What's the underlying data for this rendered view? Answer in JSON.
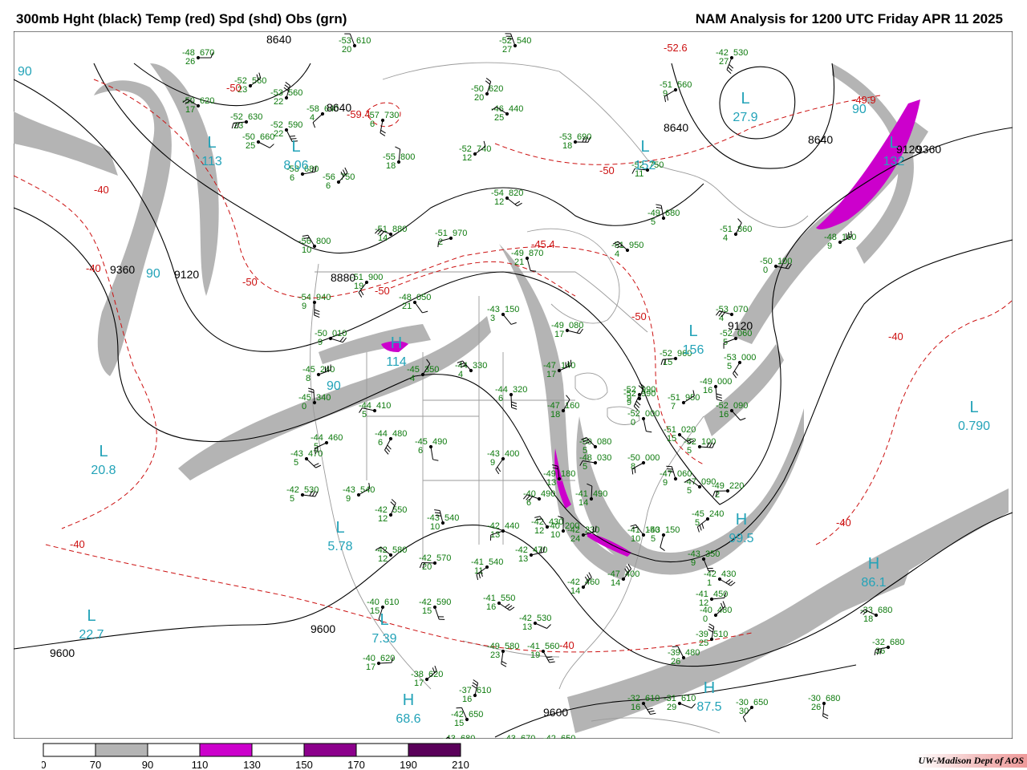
{
  "title_left": "300mb Hght (black) Temp (red) Spd (shd) Obs (grn)",
  "title_right": "NAM Analysis for 1200 UTC Friday  APR 11 2025",
  "credit": "UW-Madison  Dept of AOS",
  "colors": {
    "height": "#000000",
    "temp": "#cc1111",
    "obs": "#0d7a0d",
    "centers": "#23a3b8",
    "boundary": "#9a9a9a",
    "speed_70_90": "#b4b4b4",
    "speed_90_110": "#ffffff",
    "speed_110_130": "#cc00cc",
    "speed_130_150": "#ffffff",
    "speed_150_170": "#8c008c",
    "speed_170_190": "#ffffff",
    "speed_190_210": "#5a005a"
  },
  "colorbar": {
    "ticks": [
      "0",
      "70",
      "90",
      "110",
      "130",
      "150",
      "170",
      "190",
      "210"
    ],
    "fills": [
      "#ffffff",
      "#b4b4b4",
      "#ffffff",
      "#cc00cc",
      "#ffffff",
      "#8c008c",
      "#ffffff",
      "#5a005a",
      "#ffffff"
    ]
  },
  "height_labels": [
    "8640",
    "8640",
    "8640",
    "8880",
    "9120",
    "9120",
    "9120",
    "9360",
    "9360",
    "9600",
    "9600",
    "9600",
    "8640"
  ],
  "temp_labels": [
    "-40",
    "-40",
    "-40",
    "-40",
    "-40",
    "-40",
    "-50",
    "-50",
    "-50",
    "-50",
    "-50",
    "-52.6",
    "-49.9",
    "-59.4",
    "-45.4"
  ],
  "centers": [
    {
      "type": "L",
      "value": "8.06"
    },
    {
      "type": "L",
      "value": "113"
    },
    {
      "type": "L",
      "value": "27.9"
    },
    {
      "type": "L",
      "value": "132"
    },
    {
      "type": "H",
      "value": "114"
    },
    {
      "type": "L",
      "value": "20.8"
    },
    {
      "type": "L",
      "value": "5.78"
    },
    {
      "type": "L",
      "value": "22.7"
    },
    {
      "type": "L",
      "value": "7.39"
    },
    {
      "type": "H",
      "value": "68.6"
    },
    {
      "type": "H",
      "value": "86.1"
    },
    {
      "type": "H",
      "value": "99.5"
    },
    {
      "type": "L",
      "value": "0.790"
    },
    {
      "type": "L",
      "value": "156"
    },
    {
      "type": "H",
      "value": "87.5"
    },
    {
      "type": "L",
      "value": "152"
    }
  ],
  "speed_labels": [
    "90",
    "90",
    "90",
    "90"
  ],
  "observations": [
    {
      "temp": "-48",
      "hgt": "670",
      "dew": "26"
    },
    {
      "temp": "-52",
      "hgt": "560",
      "dew": "23"
    },
    {
      "temp": "-53",
      "hgt": "560",
      "dew": "22"
    },
    {
      "temp": "-53",
      "hgt": "610",
      "dew": "20"
    },
    {
      "temp": "-50",
      "hgt": "620",
      "dew": "17"
    },
    {
      "temp": "-52",
      "hgt": "630",
      "dew": "23"
    },
    {
      "temp": "-58",
      "hgt": "640",
      "dew": "4"
    },
    {
      "temp": "-57",
      "hgt": "730",
      "dew": "6"
    },
    {
      "temp": "-52",
      "hgt": "590",
      "dew": "22"
    },
    {
      "temp": "-50",
      "hgt": "660",
      "dew": "25"
    },
    {
      "temp": "-58",
      "hgt": "680",
      "dew": "6"
    },
    {
      "temp": "-56",
      "hgt": "750",
      "dew": "6"
    },
    {
      "temp": "-55",
      "hgt": "800",
      "dew": "18"
    },
    {
      "temp": "-56",
      "hgt": "800",
      "dew": "10"
    },
    {
      "temp": "-51",
      "hgt": "880",
      "dew": "14"
    },
    {
      "temp": "-51",
      "hgt": "970",
      "dew": "2"
    },
    {
      "temp": "-51",
      "hgt": "900",
      "dew": "19"
    },
    {
      "temp": "-54",
      "hgt": "940",
      "dew": "9"
    },
    {
      "temp": "-48",
      "hgt": "050",
      "dew": "21"
    },
    {
      "temp": "-50",
      "hgt": "010",
      "dew": "9"
    },
    {
      "temp": "-45",
      "hgt": "240",
      "dew": "8"
    },
    {
      "temp": "-45",
      "hgt": "350",
      "dew": "4"
    },
    {
      "temp": "-45",
      "hgt": "340",
      "dew": "0"
    },
    {
      "temp": "-44",
      "hgt": "330",
      "dew": "4"
    },
    {
      "temp": "-44",
      "hgt": "410",
      "dew": "5"
    },
    {
      "temp": "-44",
      "hgt": "460",
      "dew": "5"
    },
    {
      "temp": "-44",
      "hgt": "480",
      "dew": "6"
    },
    {
      "temp": "-45",
      "hgt": "490",
      "dew": "6"
    },
    {
      "temp": "-43",
      "hgt": "470",
      "dew": "5"
    },
    {
      "temp": "-42",
      "hgt": "530",
      "dew": "5"
    },
    {
      "temp": "-43",
      "hgt": "540",
      "dew": "9"
    },
    {
      "temp": "-42",
      "hgt": "550",
      "dew": "12"
    },
    {
      "temp": "-43",
      "hgt": "540",
      "dew": "10"
    },
    {
      "temp": "-42",
      "hgt": "580",
      "dew": "12"
    },
    {
      "temp": "-42",
      "hgt": "570",
      "dew": "20"
    },
    {
      "temp": "-41",
      "hgt": "540",
      "dew": "11"
    },
    {
      "temp": "-40",
      "hgt": "610",
      "dew": "15"
    },
    {
      "temp": "-42",
      "hgt": "590",
      "dew": "15"
    },
    {
      "temp": "-41",
      "hgt": "550",
      "dew": "16"
    },
    {
      "temp": "-40",
      "hgt": "620",
      "dew": "17"
    },
    {
      "temp": "-38",
      "hgt": "620",
      "dew": "17"
    },
    {
      "temp": "-37",
      "hgt": "610",
      "dew": "16"
    },
    {
      "temp": "-42",
      "hgt": "650",
      "dew": "15"
    },
    {
      "temp": "-43",
      "hgt": "680",
      "dew": "15"
    },
    {
      "temp": "-43",
      "hgt": "670",
      "dew": "12"
    },
    {
      "temp": "-42",
      "hgt": "650",
      "dew": "12"
    },
    {
      "temp": "-49",
      "hgt": "580",
      "dew": "23"
    },
    {
      "temp": "-41",
      "hgt": "560",
      "dew": "19"
    },
    {
      "temp": "-42",
      "hgt": "530",
      "dew": "13"
    },
    {
      "temp": "-42",
      "hgt": "470",
      "dew": "13"
    },
    {
      "temp": "-42",
      "hgt": "460",
      "dew": "14"
    },
    {
      "temp": "-41",
      "hgt": "490",
      "dew": "14"
    },
    {
      "temp": "-42",
      "hgt": "430",
      "dew": "12"
    },
    {
      "temp": "-40",
      "hgt": "490",
      "dew": "6"
    },
    {
      "temp": "-42",
      "hgt": "440",
      "dew": "13"
    },
    {
      "temp": "-43",
      "hgt": "400",
      "dew": "9"
    },
    {
      "temp": "-44",
      "hgt": "320",
      "dew": "6"
    },
    {
      "temp": "-43",
      "hgt": "150",
      "dew": "3"
    },
    {
      "temp": "-49",
      "hgt": "080",
      "dew": "17"
    },
    {
      "temp": "-47",
      "hgt": "140",
      "dew": "17"
    },
    {
      "temp": "-47",
      "hgt": "160",
      "dew": "18"
    },
    {
      "temp": "-49",
      "hgt": "180",
      "dew": "13"
    },
    {
      "temp": "-50",
      "hgt": "080",
      "dew": "5"
    },
    {
      "temp": "-48",
      "hgt": "030",
      "dew": "5"
    },
    {
      "temp": "-50",
      "hgt": "000",
      "dew": "8"
    },
    {
      "temp": "-52",
      "hgt": "990",
      "dew": "9"
    },
    {
      "temp": "-52",
      "hgt": "000",
      "dew": "0"
    },
    {
      "temp": "-51",
      "hgt": "020",
      "dew": "15"
    },
    {
      "temp": "-52",
      "hgt": "100",
      "dew": "5"
    },
    {
      "temp": "-51",
      "hgt": "950",
      "dew": "7"
    },
    {
      "temp": "-52",
      "hgt": "990",
      "dew": "9"
    },
    {
      "temp": "-47",
      "hgt": "060",
      "dew": "9"
    },
    {
      "temp": "-47",
      "hgt": "090",
      "dew": "5"
    },
    {
      "temp": "-49",
      "hgt": "220",
      "dew": "2"
    },
    {
      "temp": "-45",
      "hgt": "240",
      "dew": "5"
    },
    {
      "temp": "-43",
      "hgt": "150",
      "dew": "5"
    },
    {
      "temp": "-43",
      "hgt": "350",
      "dew": "9"
    },
    {
      "temp": "-42",
      "hgt": "430",
      "dew": "1"
    },
    {
      "temp": "-41",
      "hgt": "450",
      "dew": "12"
    },
    {
      "temp": "-40",
      "hgt": "480",
      "dew": "0"
    },
    {
      "temp": "-39",
      "hgt": "510",
      "dew": "25"
    },
    {
      "temp": "-39",
      "hgt": "480",
      "dew": "26"
    },
    {
      "temp": "-33",
      "hgt": "680",
      "dew": "18"
    },
    {
      "temp": "-32",
      "hgt": "680",
      "dew": "36"
    },
    {
      "temp": "-30",
      "hgt": "650",
      "dew": "30"
    },
    {
      "temp": "-30",
      "hgt": "680",
      "dew": "26"
    },
    {
      "temp": "-32",
      "hgt": "610",
      "dew": "16"
    },
    {
      "temp": "-31",
      "hgt": "610",
      "dew": "29"
    },
    {
      "temp": "-42",
      "hgt": "230",
      "dew": "24"
    },
    {
      "temp": "-47",
      "hgt": "400",
      "dew": "14"
    },
    {
      "temp": "-40",
      "hgt": "200",
      "dew": "10"
    },
    {
      "temp": "-41",
      "hgt": "150",
      "dew": "10"
    },
    {
      "temp": "-53",
      "hgt": "070",
      "dew": "4"
    },
    {
      "temp": "-52",
      "hgt": "060",
      "dew": "5"
    },
    {
      "temp": "-53",
      "hgt": "000",
      "dew": "5"
    },
    {
      "temp": "-49",
      "hgt": "000",
      "dew": "16"
    },
    {
      "temp": "-52",
      "hgt": "090",
      "dew": "16"
    },
    {
      "temp": "-50",
      "hgt": "100",
      "dew": "0"
    },
    {
      "temp": "-48",
      "hgt": "160",
      "dew": "9"
    },
    {
      "temp": "-51",
      "hgt": "860",
      "dew": "4"
    },
    {
      "temp": "-49",
      "hgt": "680",
      "dew": "5"
    },
    {
      "temp": "-51",
      "hgt": "950",
      "dew": "4"
    },
    {
      "temp": "-52",
      "hgt": "750",
      "dew": "11"
    },
    {
      "temp": "-51",
      "hgt": "560",
      "dew": "9"
    },
    {
      "temp": "-42",
      "hgt": "530",
      "dew": "27"
    },
    {
      "temp": "-49",
      "hgt": "870",
      "dew": "21"
    },
    {
      "temp": "-54",
      "hgt": "820",
      "dew": "12"
    },
    {
      "temp": "-53",
      "hgt": "690",
      "dew": "18"
    },
    {
      "temp": "-52",
      "hgt": "740",
      "dew": "12"
    },
    {
      "temp": "-50",
      "hgt": "620",
      "dew": "20"
    },
    {
      "temp": "-52",
      "hgt": "540",
      "dew": "27"
    },
    {
      "temp": "-46",
      "hgt": "440",
      "dew": "25"
    },
    {
      "temp": "-52",
      "hgt": "960",
      "dew": "15"
    }
  ]
}
